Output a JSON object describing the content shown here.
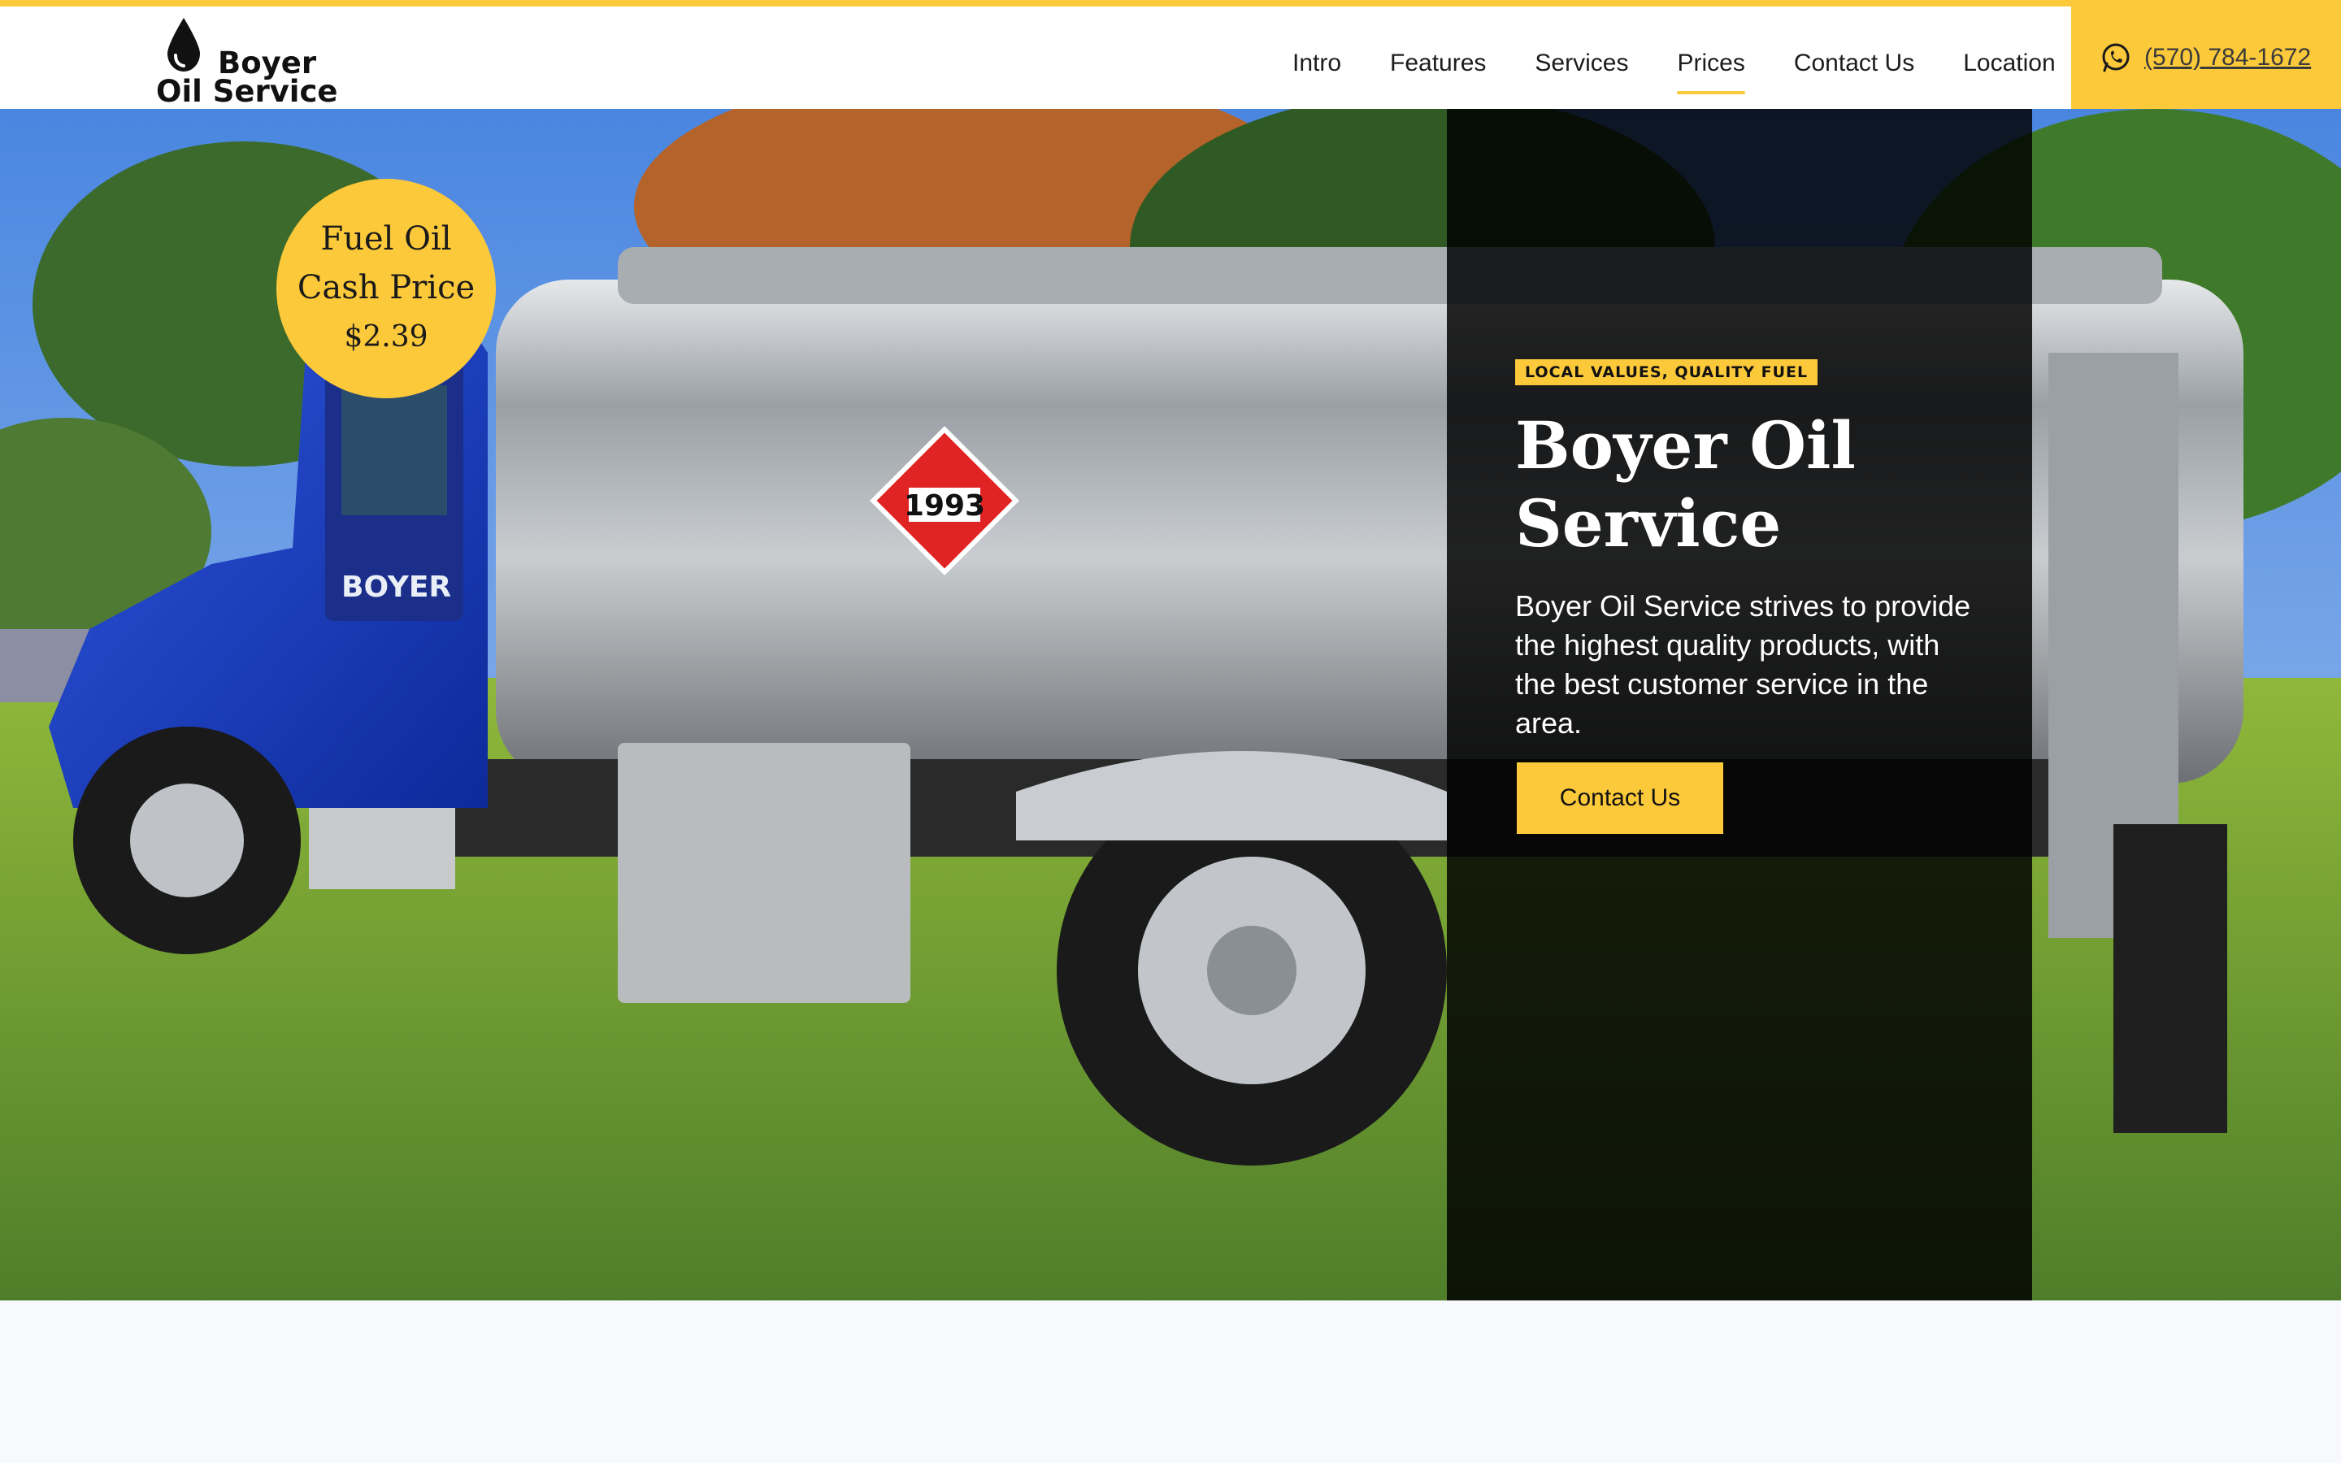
{
  "brand": {
    "line1": "Boyer",
    "line2": "Oil Service"
  },
  "nav": {
    "items": [
      "Intro",
      "Features",
      "Services",
      "Prices",
      "Contact Us",
      "Location"
    ],
    "active": "Prices"
  },
  "phone": {
    "icon": "whatsapp-icon",
    "number": "(570) 784-1672"
  },
  "price_badge": {
    "line1": "Fuel Oil",
    "line2": "Cash Price",
    "amount": "$2.39"
  },
  "hero": {
    "tagline": "LOCAL VALUES, QUALITY FUEL",
    "title": "Boyer Oil Service",
    "description": "Boyer Oil Service strives to provide the highest quality products, with the best customer service in the area.",
    "cta_label": "Contact Us",
    "image_subject": "Blue fuel oil delivery tank truck on grass",
    "truck_door_text": "BOYER",
    "placard_number": "1993"
  },
  "colors": {
    "accent": "#fcc93a",
    "panel": "#000000",
    "text_dark": "#1c1c1c"
  }
}
